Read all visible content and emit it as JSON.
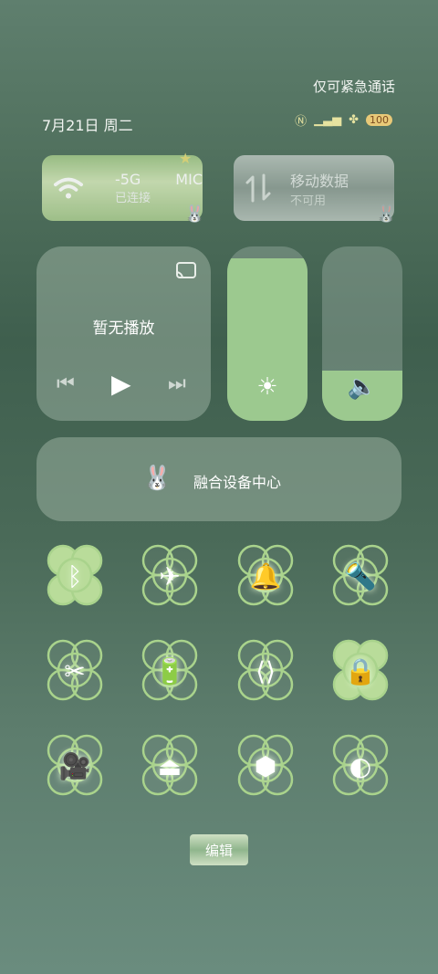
{
  "status": {
    "emergency_only": "仅可紧急通话",
    "date": "7月21日 周二",
    "battery": "100"
  },
  "wifi_tile": {
    "title": "-5G",
    "suffix": "MIC",
    "subtitle": "已连接"
  },
  "mobile_tile": {
    "title": "移动数据",
    "subtitle": "不可用"
  },
  "media": {
    "title": "暂无播放"
  },
  "brightness": {
    "level_pct": 93
  },
  "volume": {
    "level_pct": 29
  },
  "device_center": {
    "label": "融合设备中心"
  },
  "quick_settings": [
    {
      "name": "bluetooth",
      "active": true,
      "icon": "bluetooth-icon"
    },
    {
      "name": "airplane",
      "active": false,
      "icon": "airplane-icon"
    },
    {
      "name": "bell",
      "active": false,
      "icon": "bell-icon"
    },
    {
      "name": "flashlight",
      "active": false,
      "icon": "flashlight-icon"
    },
    {
      "name": "screenshot",
      "active": false,
      "icon": "scissors-icon"
    },
    {
      "name": "battery-saver",
      "active": false,
      "icon": "battery-plus-icon"
    },
    {
      "name": "vpn-link",
      "active": false,
      "icon": "link-icon"
    },
    {
      "name": "rotation-lock",
      "active": true,
      "icon": "rotation-lock-icon"
    },
    {
      "name": "screen-record",
      "active": false,
      "icon": "video-icon"
    },
    {
      "name": "screen-cast",
      "active": false,
      "icon": "cast-icon"
    },
    {
      "name": "settings",
      "active": false,
      "icon": "hexagon-icon"
    },
    {
      "name": "dark-mode",
      "active": false,
      "icon": "contrast-icon"
    }
  ],
  "edit_label": "编辑"
}
